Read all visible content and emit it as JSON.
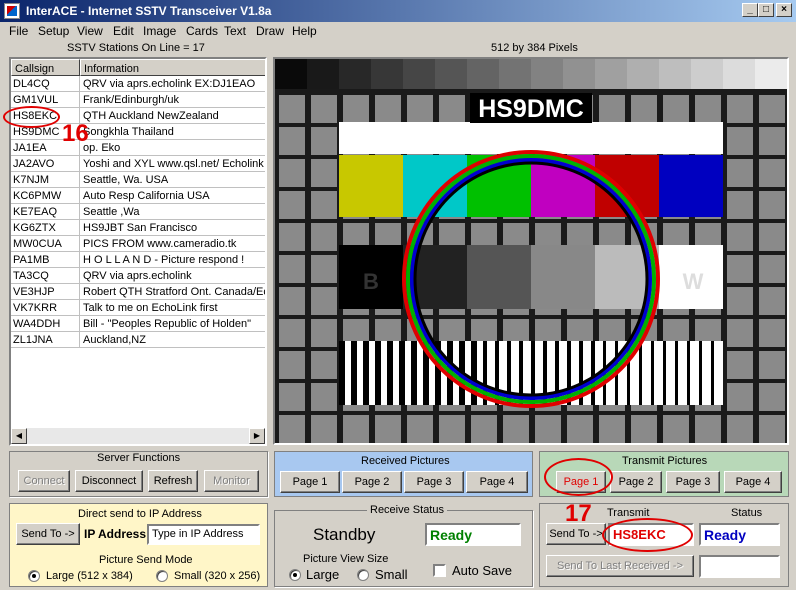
{
  "window": {
    "title": "InterACE - Internet SSTV Transceiver V1.8a"
  },
  "menu": [
    "File",
    "Setup",
    "View",
    "Edit",
    "Image",
    "Cards",
    "Text",
    "Draw",
    "Help"
  ],
  "stations_online": "SSTV Stations On Line = 17",
  "image_size": "512 by 384 Pixels",
  "list": {
    "col_callsign": "Callsign",
    "col_information": "Information",
    "rows": [
      {
        "call": "DL4CQ",
        "info": "QRV via aprs.echolink EX:DJ1EAO"
      },
      {
        "call": "GM1VUL",
        "info": "Frank/Edinburgh/uk"
      },
      {
        "call": "HS8EKC",
        "info": "QTH Auckland NewZealand"
      },
      {
        "call": "HS9DMC",
        "info": "Songkhla Thailand"
      },
      {
        "call": "JA1EA",
        "info": "op. Eko"
      },
      {
        "call": "JA2AVO",
        "info": "Yoshi and XYL www.qsl.net/  Echolink"
      },
      {
        "call": "K7NJM",
        "info": "Seattle, Wa. USA"
      },
      {
        "call": "KC6PMW",
        "info": "Auto Resp  California USA"
      },
      {
        "call": "KE7EAQ",
        "info": "Seattle ,Wa"
      },
      {
        "call": "KG6ZTX",
        "info": "HS9JBT  San Francisco"
      },
      {
        "call": "MW0CUA",
        "info": "PICS FROM www.cameradio.tk"
      },
      {
        "call": "PA1MB",
        "info": "H O L L A N D  - Picture respond !"
      },
      {
        "call": "TA3CQ",
        "info": "QRV via aprs.echolink"
      },
      {
        "call": "VE3HJP",
        "info": "Robert QTH Stratford Ont. Canada/Ec"
      },
      {
        "call": "VK7KRR",
        "info": "Talk to me on EchoLink first"
      },
      {
        "call": "WA4DDH",
        "info": "Bill - \"Peoples Republic of Holden\""
      },
      {
        "call": "ZL1JNA",
        "info": "Auckland,NZ"
      }
    ]
  },
  "testcard": {
    "callsign": "HS9DMC",
    "b_label": "B",
    "w_label": "W",
    "bar_colors": [
      "#c8c800",
      "#00c8c8",
      "#00c000",
      "#c000c0",
      "#c00000",
      "#0000c0"
    ]
  },
  "annotations": {
    "a16": "16",
    "a17": "17"
  },
  "server": {
    "title": "Server Functions",
    "connect": "Connect",
    "disconnect": "Disconnect",
    "refresh": "Refresh",
    "monitor": "Monitor"
  },
  "received": {
    "title": "Received Pictures",
    "pages": [
      "Page 1",
      "Page 2",
      "Page 3",
      "Page 4"
    ]
  },
  "transmit_pics": {
    "title": "Transmit Pictures",
    "pages": [
      "Page 1",
      "Page 2",
      "Page 3",
      "Page 4"
    ]
  },
  "direct": {
    "title": "Direct send to IP Address",
    "send_to": "Send To ->",
    "ip_label": "IP Address",
    "ip_placeholder": "Type in IP Address"
  },
  "send_mode": {
    "title": "Picture Send Mode",
    "large": "Large (512 x 384)",
    "small": "Small (320 x 256)"
  },
  "receive_status": {
    "title": "Receive Status",
    "standby": "Standby",
    "ready": "Ready"
  },
  "view_size": {
    "title": "Picture View Size",
    "large": "Large",
    "small": "Small"
  },
  "auto_save": "Auto Save",
  "transmit": {
    "title": "Transmit",
    "send_to": "Send To ->",
    "callsign": "HS8EKC",
    "status_title": "Status",
    "status": "Ready",
    "send_last": "Send To  Last Received ->"
  }
}
